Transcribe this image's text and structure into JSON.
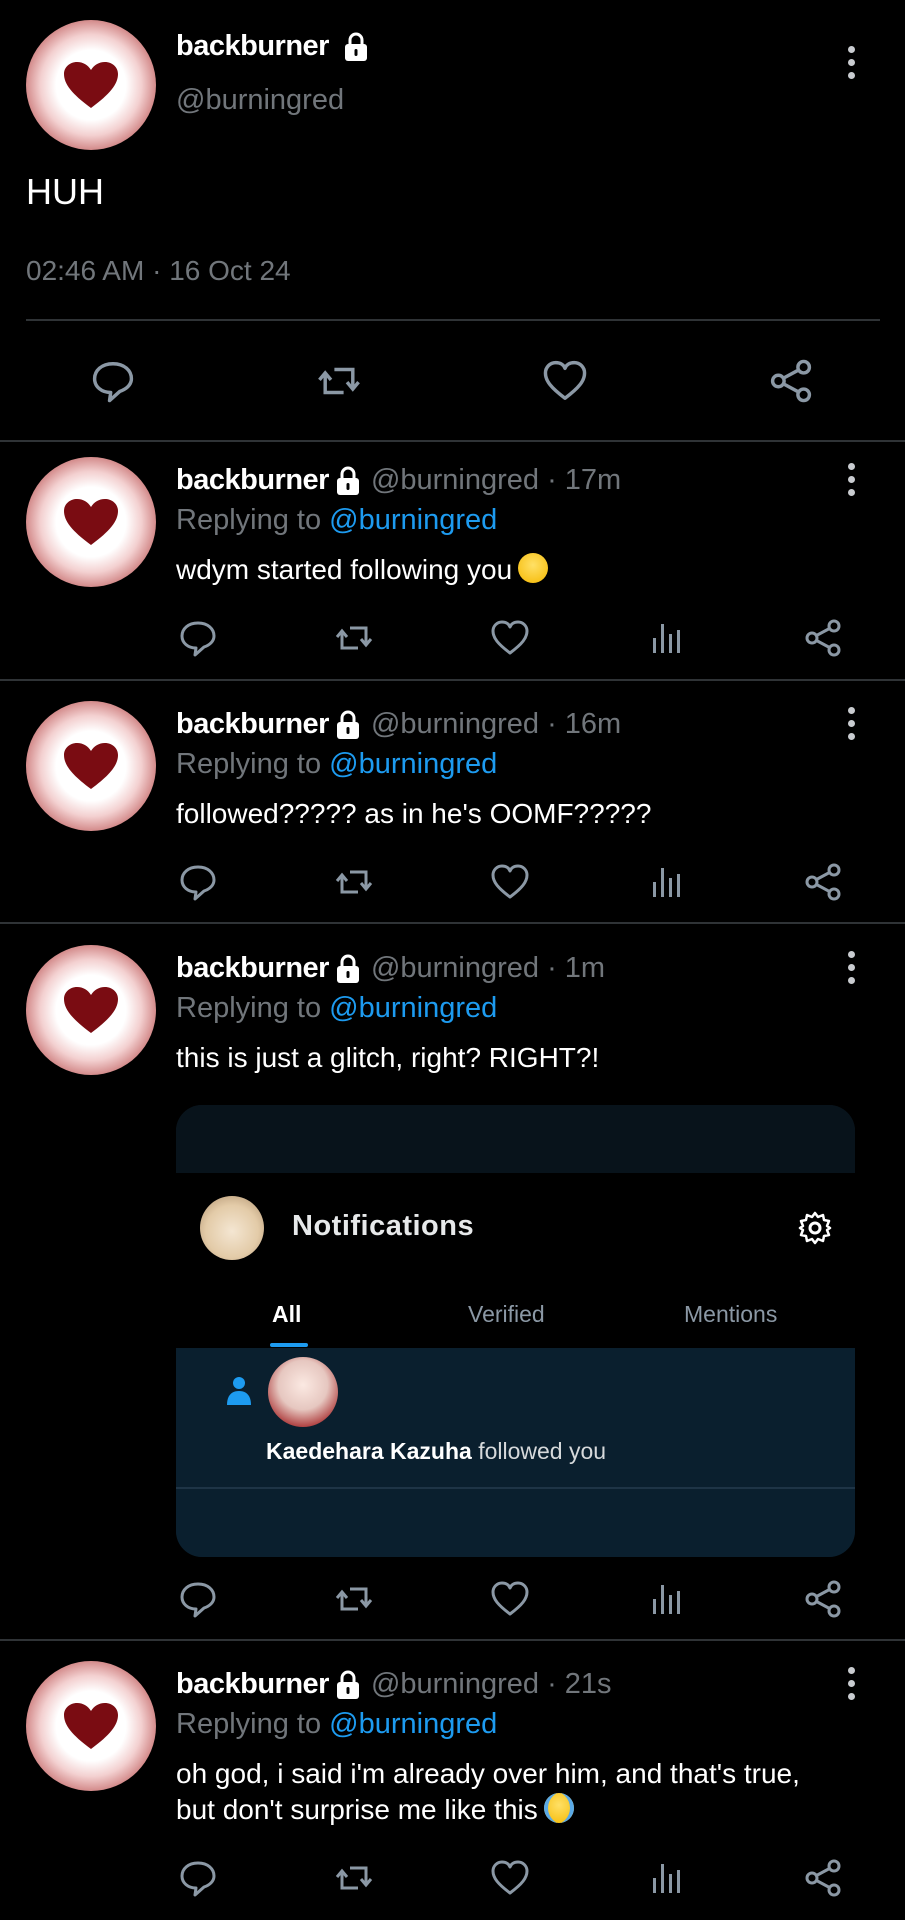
{
  "main_post": {
    "display_name": "backburner",
    "handle": "@burningred",
    "text": "HUH",
    "timestamp": "02:46 AM",
    "date": "16 Oct 24",
    "separator": "·"
  },
  "replies": [
    {
      "display_name": "backburner",
      "handle": "@burningred",
      "dot": "·",
      "age": "17m",
      "replying_prefix": "Replying to",
      "replying_handle": "@burningred",
      "text": "wdym started following you",
      "emoji": "grinning-face"
    },
    {
      "display_name": "backburner",
      "handle": "@burningred",
      "dot": "·",
      "age": "16m",
      "replying_prefix": "Replying to",
      "replying_handle": "@burningred",
      "text": "followed????? as in he's OOMF?????"
    },
    {
      "display_name": "backburner",
      "handle": "@burningred",
      "dot": "·",
      "age": "1m",
      "replying_prefix": "Replying to",
      "replying_handle": "@burningred",
      "text": "this is just a glitch, right? RIGHT?!"
    },
    {
      "display_name": "backburner",
      "handle": "@burningred",
      "dot": "·",
      "age": "21s",
      "replying_prefix": "Replying to",
      "replying_handle": "@burningred",
      "text_line1": "oh god, i said i'm already over him, and that's true,",
      "text_line2": "but don't surprise me like this",
      "emoji": "loudly-crying-face"
    }
  ],
  "embedded_screenshot": {
    "title": "Notifications",
    "tabs": [
      {
        "label": "All",
        "active": true
      },
      {
        "label": "Verified",
        "active": false
      },
      {
        "label": "Mentions",
        "active": false
      }
    ],
    "notification": {
      "user": "Kaedehara Kazuha",
      "action": "followed you"
    }
  },
  "icons": {
    "reply": "reply-icon",
    "repost": "repost-icon",
    "like": "like-icon",
    "views": "views-icon",
    "share": "share-icon",
    "more": "more-icon",
    "lock": "lock-icon"
  },
  "colors": {
    "background": "#000000",
    "link": "#1d9bf0",
    "muted": "#71767b",
    "heart": "#7a0c12"
  }
}
